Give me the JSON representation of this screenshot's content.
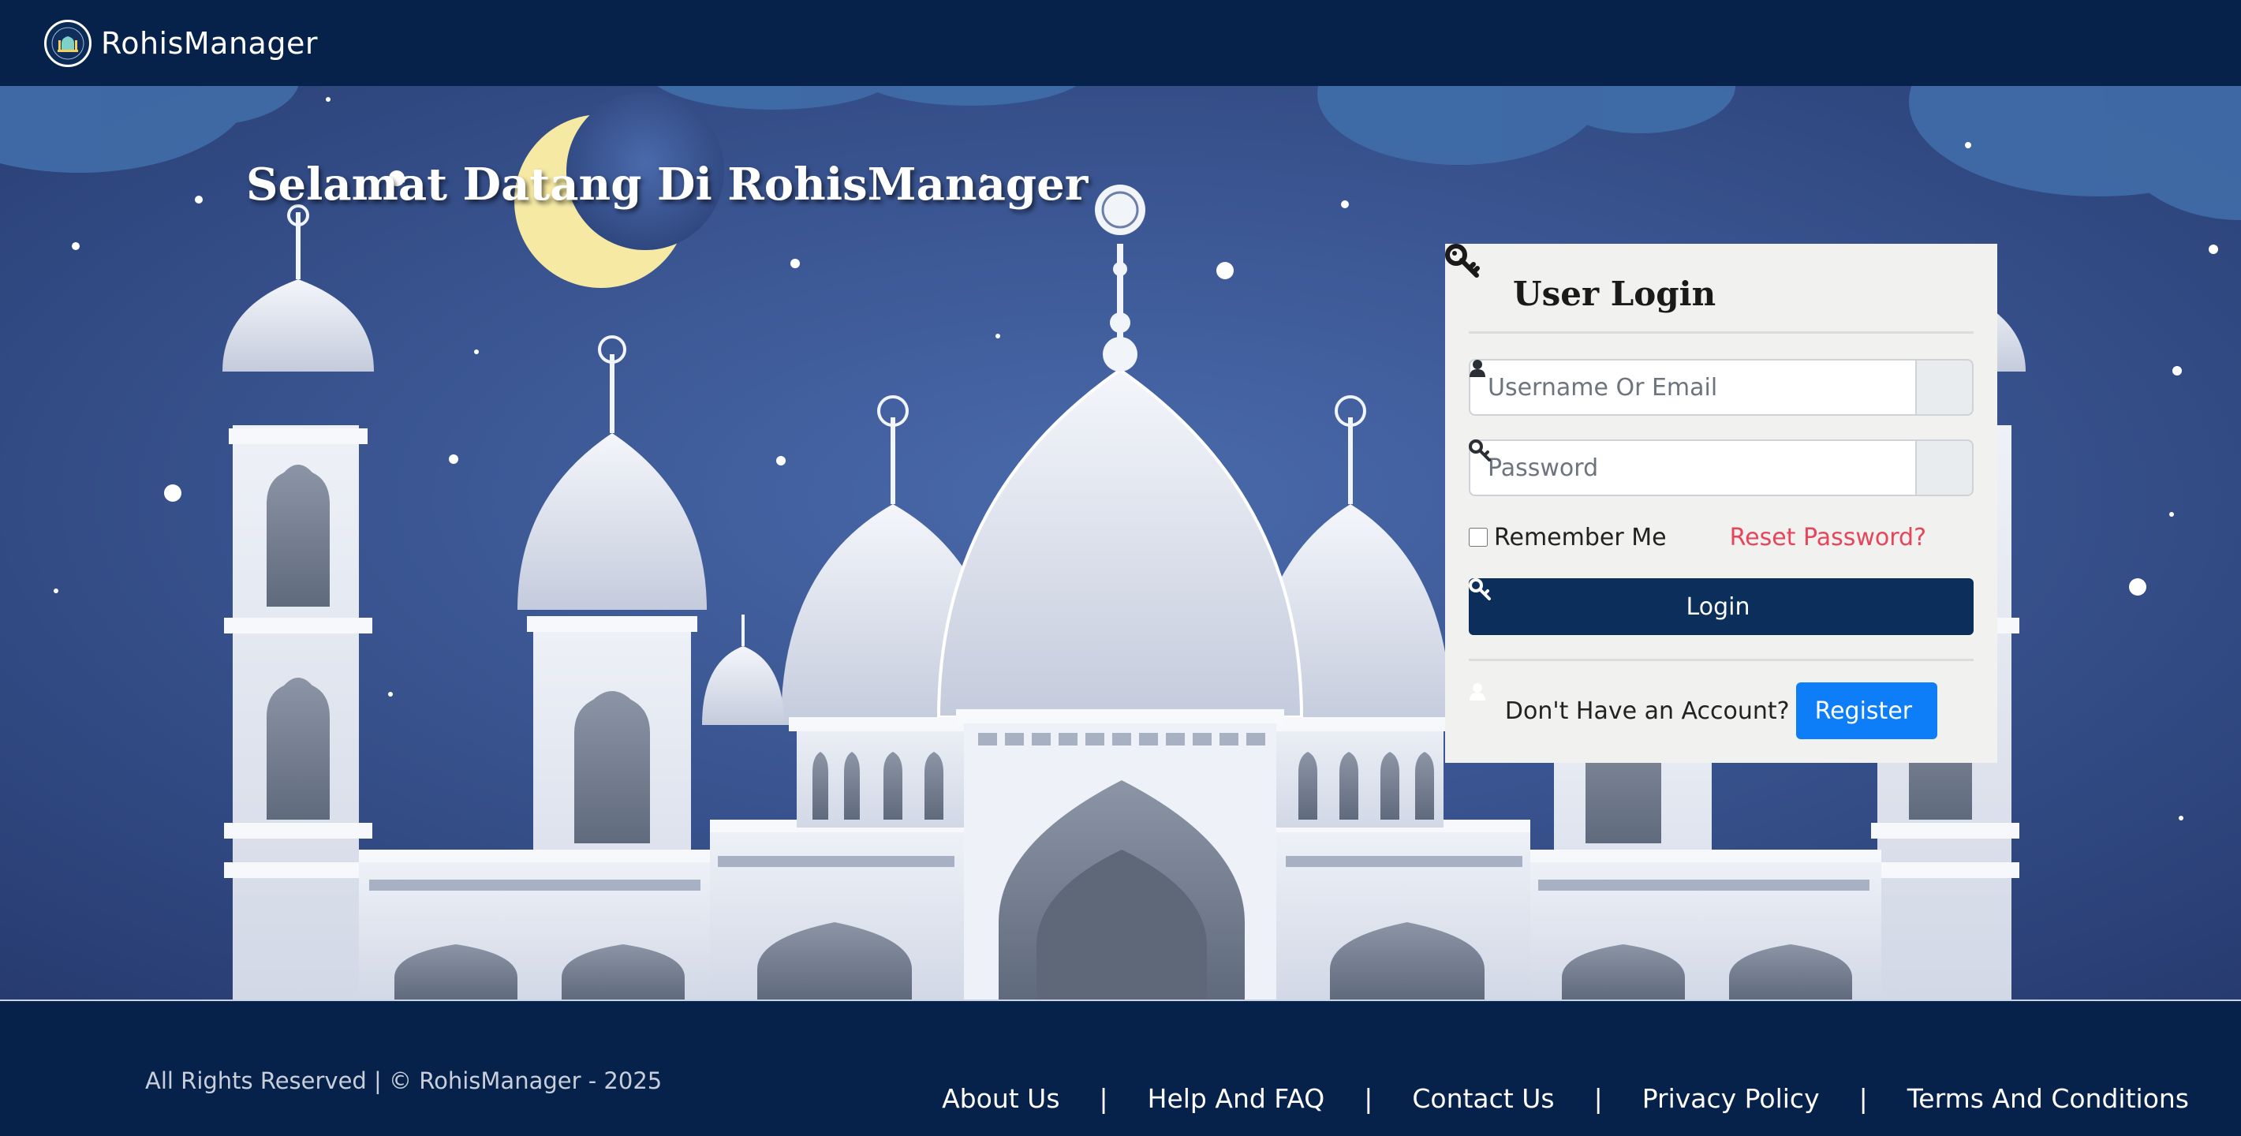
{
  "navbar": {
    "brand_name": "RohisManager",
    "logo_icon": "mosque-logo-icon"
  },
  "hero": {
    "title": "Selamat Datang Di RohisManager",
    "background_colors": {
      "sky_top": "#2b3f72",
      "sky_mid": "#4565a3",
      "clouds": "#3c6aa6",
      "mosque": "#e8ecf5"
    }
  },
  "login": {
    "title": "User Login",
    "title_icon": "key-icon",
    "username_placeholder": "Username Or Email",
    "username_icon": "user-icon",
    "password_placeholder": "Password",
    "password_icon": "key-icon",
    "remember_label": "Remember Me",
    "reset_link": "Reset Password?",
    "login_button": "Login",
    "no_account_text": "Don't Have an Account?",
    "register_button": "Register",
    "colors": {
      "login_button": "#0b2f5a",
      "register_button": "#0d7ef7",
      "reset_link": "#e8445a"
    }
  },
  "footer": {
    "copyright": "All Rights Reserved | © RohisManager - 2025",
    "links": [
      "About Us",
      "Help And FAQ",
      "Contact Us",
      "Privacy Policy",
      "Terms And Conditions"
    ],
    "separator": "|"
  }
}
